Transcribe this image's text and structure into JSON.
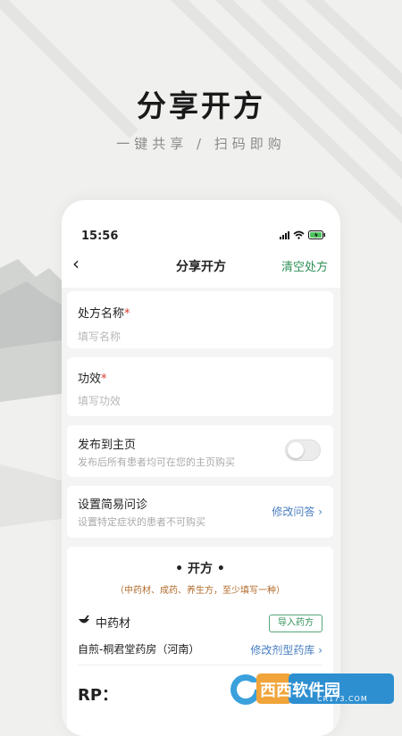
{
  "promo": {
    "title": "分享开方",
    "subtitle": "一键共享 / 扫码即购"
  },
  "status": {
    "time": "15:56"
  },
  "nav": {
    "back_icon": "‹",
    "title": "分享开方",
    "right_action": "清空处方"
  },
  "form": {
    "name_label": "处方名称",
    "name_placeholder": "填写名称",
    "effect_label": "功效",
    "effect_placeholder": "填写功效",
    "required_mark": "*",
    "publish_label": "发布到主页",
    "publish_hint": "发布后所有患者均可在您的主页购买",
    "publish_on": false,
    "consult_label": "设置简易问诊",
    "consult_hint": "设置特定症状的患者不可购买",
    "consult_link": "修改问答",
    "chevron": "›"
  },
  "prescription": {
    "title": "• 开方 •",
    "note": "（中药材、成药、养生方，至少填写一种）",
    "herb_label": "中药材",
    "import_button": "导入药方",
    "pharmacy": "自煎-桐君堂药房（河南）",
    "modify_link": "修改剂型药库",
    "rp_label": "RP："
  },
  "watermark": {
    "text": "西西软件园",
    "url": "CR173.COM"
  },
  "colors": {
    "accent_green": "#2f8f58",
    "link_blue": "#4a7fc1",
    "required_red": "#d83b2f",
    "note_orange": "#b06a2a"
  }
}
